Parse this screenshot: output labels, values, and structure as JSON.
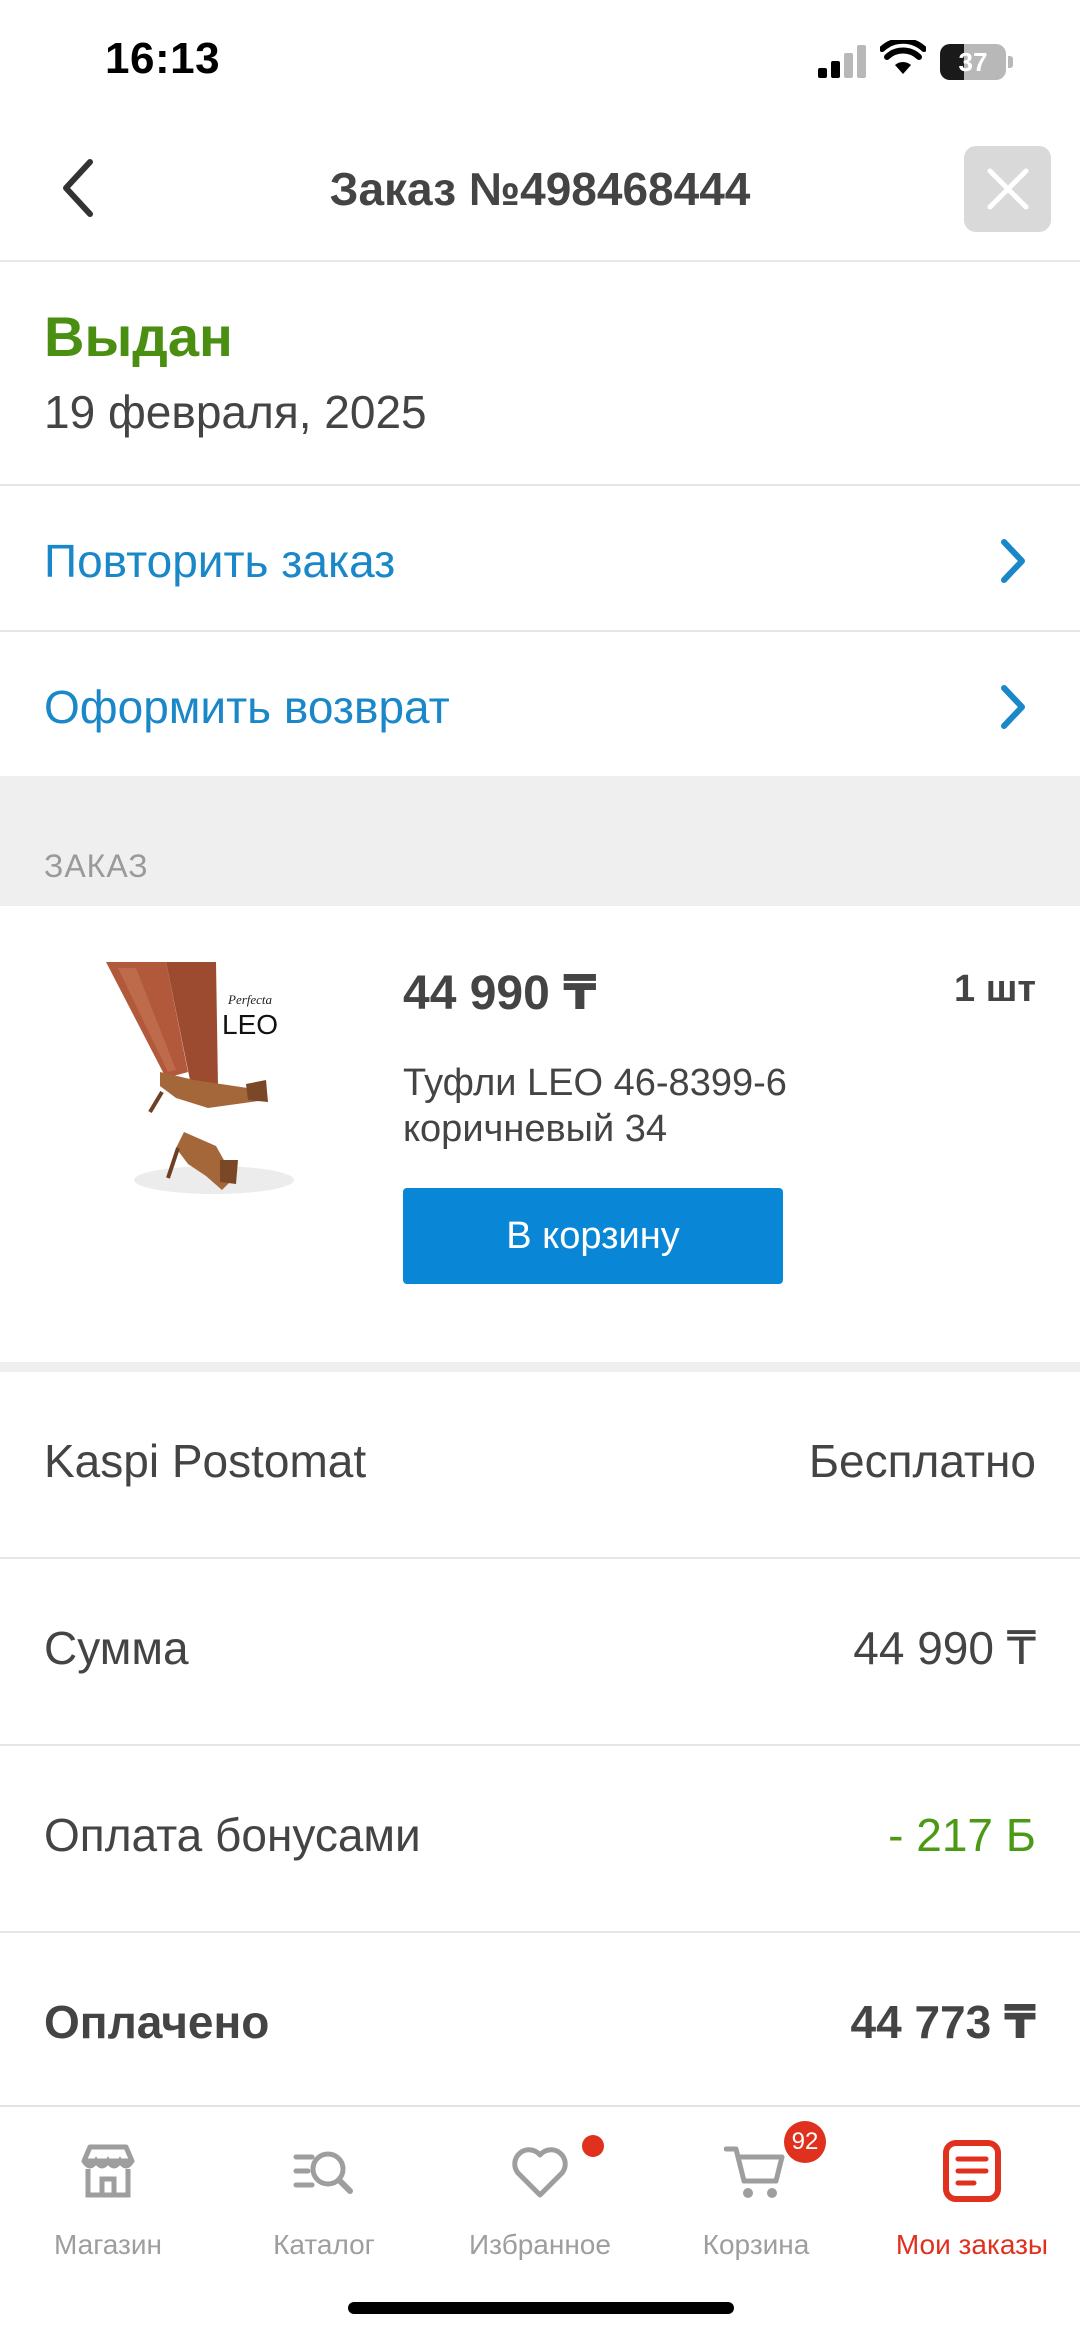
{
  "status_bar": {
    "time": "16:13",
    "battery": "37",
    "battery_level": 0.37
  },
  "header": {
    "title": "Заказ №498468444"
  },
  "order": {
    "status": "Выдан",
    "date": "19 февраля, 2025"
  },
  "actions": [
    {
      "label": "Повторить заказ"
    },
    {
      "label": "Оформить возврат"
    }
  ],
  "section": {
    "label": "ЗАКАЗ"
  },
  "product": {
    "price": "44 990 ₸",
    "quantity": "1 шт",
    "name": "Туфли LEO 46-8399-6 коричневый 34",
    "cart_button": "В корзину",
    "image_brand_small": "Perfecta",
    "image_brand": "LEO"
  },
  "summary": {
    "delivery_label": "Kaspi Postomat",
    "delivery_value": "Бесплатно",
    "sum_label": "Сумма",
    "sum_value": "44 990 ₸",
    "bonus_label": "Оплата бонусами",
    "bonus_value": "- 217 Б",
    "paid_label": "Оплачено",
    "paid_value": "44 773 ₸"
  },
  "bottom_nav": {
    "items": [
      {
        "label": "Магазин",
        "icon": "store-icon"
      },
      {
        "label": "Каталог",
        "icon": "catalog-search-icon"
      },
      {
        "label": "Избранное",
        "icon": "heart-icon"
      },
      {
        "label": "Корзина",
        "icon": "cart-icon",
        "badge": "92"
      },
      {
        "label": "Мои заказы",
        "icon": "orders-icon"
      }
    ],
    "active_index": 4
  },
  "colors": {
    "accent_blue": "#1a87c9",
    "button_blue": "#0a86d6",
    "status_green": "#4a8f12",
    "bonus_green": "#4a9a16",
    "active_red": "#e0301e"
  }
}
